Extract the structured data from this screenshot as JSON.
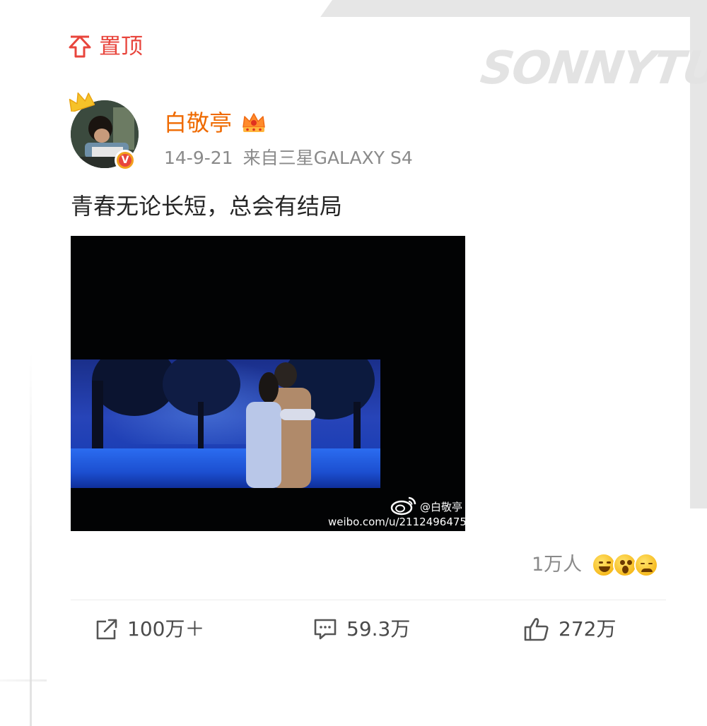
{
  "pinned": {
    "label": "置顶",
    "icon": "pin-to-top-icon"
  },
  "watermark_text": "SONNYTU",
  "post": {
    "author": {
      "name": "白敬亭",
      "avatar": "avatar",
      "badges": [
        "crown-icon",
        "verified-badge-icon",
        "vip-crown-icon"
      ],
      "verified_mark": "V"
    },
    "timestamp": "14-9-21",
    "source": "来自三星GALAXY S4",
    "text": "青春无论长短，总会有结局",
    "media": {
      "watermark_handle": "@白敬亭",
      "watermark_url": "weibo.com/u/2112496475"
    },
    "reactions": {
      "count": "1万人",
      "emojis": [
        "grin-emoji",
        "surprised-emoji",
        "crying-emoji"
      ]
    },
    "actions": {
      "repost": "100万＋",
      "comment": "59.3万",
      "like": "272万"
    }
  },
  "colors": {
    "accent_red": "#e8453c",
    "username_orange": "#ef6a00",
    "meta_gray": "#8a8a8a",
    "text": "#262626"
  }
}
